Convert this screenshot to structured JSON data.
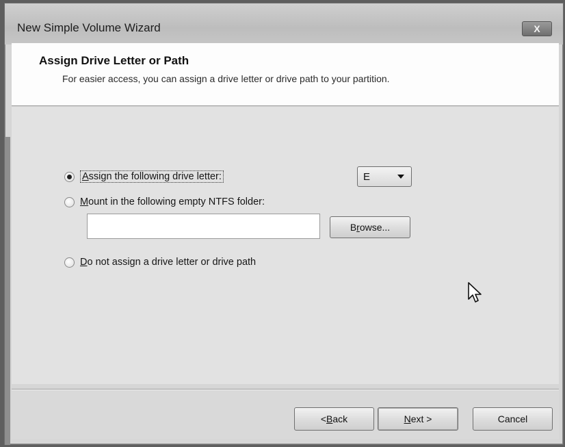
{
  "window": {
    "title": "New Simple Volume Wizard",
    "close_label": "X"
  },
  "header": {
    "title": "Assign Drive Letter or Path",
    "subtitle": "For easier access, you can assign a drive letter or drive path to your partition."
  },
  "options": {
    "assign_letter": {
      "prefix": "A",
      "rest": "ssign the following drive letter:",
      "selected": true
    },
    "mount_folder": {
      "prefix": "M",
      "rest": "ount in the following empty NTFS folder:",
      "selected": false
    },
    "no_assign": {
      "prefix": "D",
      "rest": "o not assign a drive letter or drive path",
      "selected": false
    }
  },
  "drive_letter_select": {
    "value": "E"
  },
  "folder_path_input": {
    "value": "",
    "placeholder": ""
  },
  "browse_button": {
    "prefix": "B",
    "underlined": "r",
    "rest": "owse..."
  },
  "footer": {
    "back": {
      "prefix": "< ",
      "underlined": "B",
      "rest": "ack"
    },
    "next": {
      "prefix": "",
      "underlined": "N",
      "rest": "ext >"
    },
    "cancel": {
      "label": "Cancel"
    }
  },
  "icons": [
    "close-icon",
    "chevron-down-icon",
    "mouse-pointer-icon"
  ]
}
